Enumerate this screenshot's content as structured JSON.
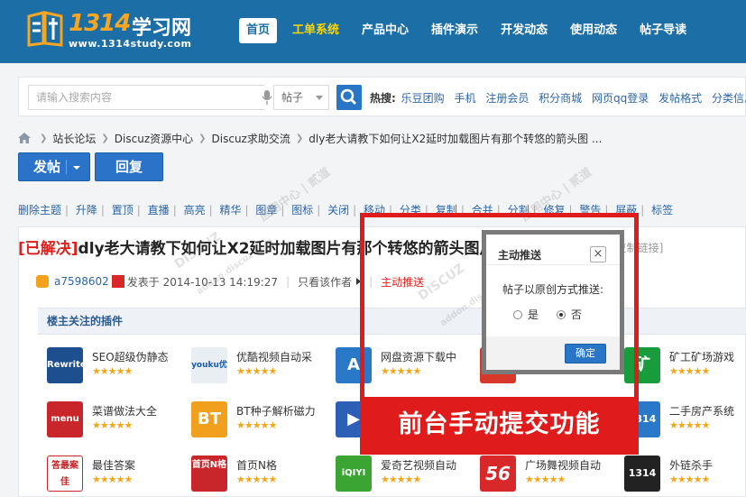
{
  "site": {
    "logo_num": "1314",
    "logo_cn": "学习网",
    "logo_url": "www.1314study.com"
  },
  "nav": [
    {
      "label": "首页"
    },
    {
      "label": "工单系统"
    },
    {
      "label": "产品中心"
    },
    {
      "label": "插件演示"
    },
    {
      "label": "开发动态"
    },
    {
      "label": "使用动态"
    },
    {
      "label": "帖子导读"
    }
  ],
  "search": {
    "placeholder": "请输入搜索内容",
    "type": "帖子",
    "hot_label": "热搜:",
    "hot_items": [
      "乐豆团购",
      "手机",
      "注册会员",
      "积分商城",
      "网页qq登录",
      "发帖格式",
      "分类信息"
    ]
  },
  "breadcrumb": [
    "站长论坛",
    "Discuz资源中心",
    "Discuz求助交流",
    "dly老大请教下如何让X2延时加载图片有那个转悠的箭头图 ..."
  ],
  "actions": {
    "post": "发帖",
    "reply": "回复"
  },
  "modbar": [
    "删除主题",
    "升降",
    "置顶",
    "直播",
    "高亮",
    "精华",
    "图章",
    "图标",
    "关闭",
    "移动",
    "分类",
    "复制",
    "合并",
    "分割",
    "修复",
    "警告",
    "屏蔽",
    "标签"
  ],
  "thread": {
    "solved": "[已解决]",
    "title": "dly老大请教下如何让X2延时加载图片有那个转悠的箭头图片，",
    "extra_link": "[复制链接]",
    "author": "a7598602",
    "posted": "发表于 2014-10-13 14:19:27",
    "only_author": "只看该作者",
    "push": "主动推送"
  },
  "plugins_title": "楼主关注的插件",
  "plugins": [
    {
      "name": "SEO超级伪静态",
      "icon": "Rewrite",
      "color": "#1d4f8f"
    },
    {
      "name": "优酷视频自动采",
      "icon": "youku优酷",
      "color": "#e9eef3"
    },
    {
      "name": "网盘资源下载中",
      "icon": "A",
      "color": "#2a78c8"
    },
    {
      "name": "",
      "icon": "1314",
      "color": "#d8382a"
    },
    {
      "name": "矿工矿场游戏",
      "icon": "矿",
      "color": "#199c3c"
    },
    {
      "name": "菜谱做法大全",
      "icon": "menu",
      "color": "#c8262a"
    },
    {
      "name": "BT种子解析磁力",
      "icon": "BT",
      "color": "#f0a01c"
    },
    {
      "name": "",
      "icon": "▶",
      "color": "#2d5fb7"
    },
    {
      "name": "",
      "icon": "",
      "color": "#ffffff"
    },
    {
      "name": "二手房产系统",
      "icon": "1314",
      "color": "#2a78c8"
    },
    {
      "name": "最佳答案",
      "icon": "答最案佳",
      "color": "#ffffff"
    },
    {
      "name": "首页N格",
      "icon": "首页N格",
      "color": "#c8262a"
    },
    {
      "name": "爱奇艺视频自动",
      "icon": "iQIYI",
      "color": "#3ba534"
    },
    {
      "name": "广场舞视频自动",
      "icon": "56",
      "color": "#d8282a"
    },
    {
      "name": "外链杀手",
      "icon": "1314",
      "color": "#222222"
    }
  ],
  "dialog": {
    "title": "主动推送",
    "close": "×",
    "question": "帖子以原创方式推送:",
    "yes": "是",
    "no": "否",
    "selected": "no",
    "confirm": "确定"
  },
  "annotation": "前台手动提交功能",
  "watermark": [
    "DISCUZ",
    "addon.discuz.com",
    "应用中心 | 贰道"
  ],
  "colors": {
    "header": "#1b6fa6",
    "accent": "#2a76c6",
    "red": "#e01b1b",
    "link": "#2b66a6",
    "star": "#f0a71c"
  }
}
